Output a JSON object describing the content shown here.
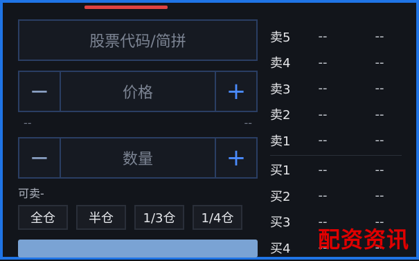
{
  "form": {
    "stock_code_placeholder": "股票代码/简拼",
    "price": {
      "minus": "−",
      "placeholder": "价格",
      "plus": "+"
    },
    "price_limits": {
      "lower": "--",
      "upper": "--"
    },
    "quantity": {
      "minus": "−",
      "placeholder": "数量",
      "plus": "+"
    },
    "available_label": "可卖-",
    "quick_positions": [
      "全仓",
      "半仓",
      "1/3仓",
      "1/4仓"
    ]
  },
  "order_book": {
    "asks": [
      {
        "label": "卖5",
        "price": "--",
        "volume": "--"
      },
      {
        "label": "卖4",
        "price": "--",
        "volume": "--"
      },
      {
        "label": "卖3",
        "price": "--",
        "volume": "--"
      },
      {
        "label": "卖2",
        "price": "--",
        "volume": "--"
      },
      {
        "label": "卖1",
        "price": "--",
        "volume": "--"
      }
    ],
    "bids": [
      {
        "label": "买1",
        "price": "--",
        "volume": "--"
      },
      {
        "label": "买2",
        "price": "--",
        "volume": "--"
      },
      {
        "label": "买3",
        "price": "--",
        "volume": "--"
      },
      {
        "label": "买4",
        "price": "--",
        "volume": "--"
      }
    ]
  },
  "watermark": "配资资讯",
  "colors": {
    "frame": "#1f74e6",
    "accent_red": "#e04343",
    "plus_blue": "#4b8cff",
    "button_blue": "#7aa3d4"
  }
}
